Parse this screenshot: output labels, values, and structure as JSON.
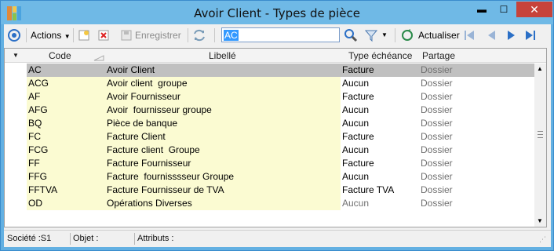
{
  "window": {
    "title": "Avoir Client -  Types de pièce",
    "minimize": "▬",
    "maximize": "☐",
    "close": "✕"
  },
  "toolbar": {
    "actions_label": "Actions",
    "save_label": "Enregistrer",
    "search_value": "AC",
    "refresh_label": "Actualiser"
  },
  "grid": {
    "columns": [
      "Code",
      "Libellé",
      "Type échéance",
      "Partage"
    ],
    "rows": [
      {
        "code": "AC",
        "label": "Avoir Client",
        "type": "Facture",
        "share": "Dossier",
        "selected": true,
        "type_gray": false
      },
      {
        "code": "ACG",
        "label": "Avoir client  groupe",
        "type": "Aucun",
        "share": "Dossier",
        "selected": false,
        "type_gray": false
      },
      {
        "code": "AF",
        "label": "Avoir Fournisseur",
        "type": "Facture",
        "share": "Dossier",
        "selected": false,
        "type_gray": false
      },
      {
        "code": "AFG",
        "label": "Avoir  fournisseur groupe",
        "type": "Aucun",
        "share": "Dossier",
        "selected": false,
        "type_gray": false
      },
      {
        "code": "BQ",
        "label": "Pièce de banque",
        "type": "Aucun",
        "share": "Dossier",
        "selected": false,
        "type_gray": false
      },
      {
        "code": "FC",
        "label": "Facture Client",
        "type": "Facture",
        "share": "Dossier",
        "selected": false,
        "type_gray": false
      },
      {
        "code": "FCG",
        "label": "Facture client  Groupe",
        "type": "Aucun",
        "share": "Dossier",
        "selected": false,
        "type_gray": false
      },
      {
        "code": "FF",
        "label": "Facture Fournisseur",
        "type": "Facture",
        "share": "Dossier",
        "selected": false,
        "type_gray": false
      },
      {
        "code": "FFG",
        "label": "Facture  fournisssseur Groupe",
        "type": "Aucun",
        "share": "Dossier",
        "selected": false,
        "type_gray": false
      },
      {
        "code": "FFTVA",
        "label": "Facture Fournisseur de TVA",
        "type": "Facture TVA",
        "share": "Dossier",
        "selected": false,
        "type_gray": false
      },
      {
        "code": "OD",
        "label": "Opérations Diverses",
        "type": "Aucun",
        "share": "Dossier",
        "selected": false,
        "type_gray": true
      }
    ]
  },
  "status": {
    "company": "Société :S1",
    "object": "Objet :",
    "attributes": "Attributs :"
  }
}
